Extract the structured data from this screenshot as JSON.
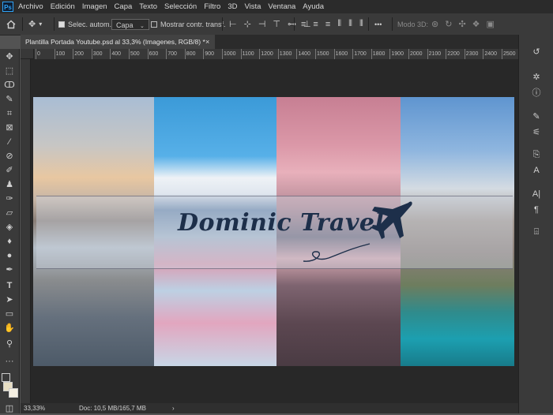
{
  "app": {
    "logo": "Ps"
  },
  "menu": [
    "Archivo",
    "Edición",
    "Imagen",
    "Capa",
    "Texto",
    "Selección",
    "Filtro",
    "3D",
    "Vista",
    "Ventana",
    "Ayuda"
  ],
  "options": {
    "auto_select_label": "Selec. autom.:",
    "auto_select_value": "Capa",
    "transform_label": "Mostrar contr. transf.",
    "more": "•••",
    "mode3d_label": "Modo 3D:"
  },
  "document": {
    "tab_title": "Plantilla Portada Youtube.psd al 33,3% (Imagenes, RGB/8) *",
    "close_glyph": "×"
  },
  "ruler": {
    "ticks": [
      "0",
      "100",
      "200",
      "300",
      "400",
      "500",
      "600",
      "700",
      "800",
      "900",
      "1000",
      "1100",
      "1200",
      "1300",
      "1400",
      "1500",
      "1600",
      "1700",
      "1800",
      "1900",
      "2000",
      "2100",
      "2200",
      "2300",
      "2400",
      "2500"
    ]
  },
  "artwork": {
    "brand_text": "Dominic Travel"
  },
  "status": {
    "zoom": "33,33%",
    "doc_size": "Doc: 10,5 MB/165,7 MB",
    "arrow": "›"
  },
  "colors": {
    "foreground": "#e8dfc4",
    "background": "#f4efe2",
    "accent": "#2fa3f7"
  },
  "tools_icons": [
    "move-icon",
    "marquee-icon",
    "lasso-icon",
    "quick-select-icon",
    "crop-icon",
    "frame-icon",
    "eyedropper-icon",
    "healing-icon",
    "brush-icon",
    "stamp-icon",
    "history-brush-icon",
    "eraser-icon",
    "gradient-icon",
    "blur-icon",
    "dodge-icon",
    "pen-icon",
    "type-icon",
    "path-select-icon",
    "rectangle-icon",
    "hand-icon",
    "zoom-icon",
    "more-tools-icon"
  ]
}
